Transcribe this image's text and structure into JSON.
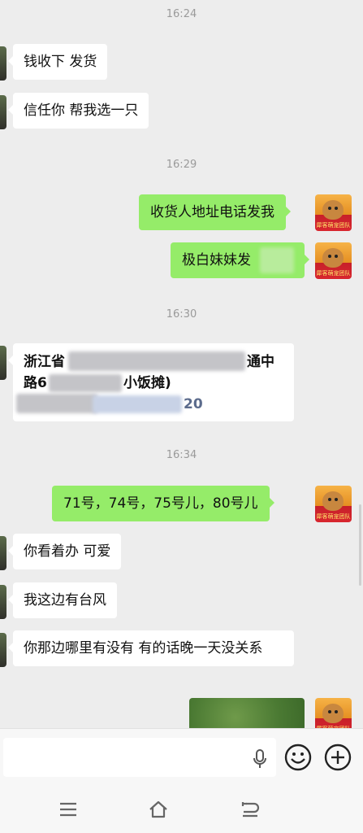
{
  "chat": {
    "timestamps": [
      "16:24",
      "16:29",
      "16:30",
      "16:34"
    ],
    "messages": [
      {
        "side": "left",
        "text": "钱收下  发货"
      },
      {
        "side": "left",
        "text": "信任你  帮我选一只"
      },
      {
        "side": "right",
        "text": "收货人地址电话发我"
      },
      {
        "side": "right",
        "text": "极白妹妹发"
      },
      {
        "side": "left",
        "line1": "浙江省",
        "line1_end": "通中",
        "line2": "路6",
        "line2_end": "小饭摊)",
        "line3_end": "20"
      },
      {
        "side": "right",
        "text": "71号，74号，75号儿，80号儿"
      },
      {
        "side": "left",
        "text": "你看着办  可爱"
      },
      {
        "side": "left",
        "text": "我这边有台风"
      },
      {
        "side": "left",
        "text": "你那边哪里有没有  有的话晚一天没关系"
      }
    ],
    "avatar_label": "犀客萌宠团队"
  },
  "input_bar": {
    "value": "",
    "icons": [
      "microphone-icon",
      "emoji-icon",
      "plus-icon"
    ]
  },
  "nav_bar": {
    "icons": [
      "menu-icon",
      "home-icon",
      "back-icon"
    ]
  },
  "colors": {
    "background": "#ededed",
    "outgoing_bubble": "#95ec69",
    "incoming_bubble": "#ffffff",
    "timestamp": "#9a9a9a"
  }
}
